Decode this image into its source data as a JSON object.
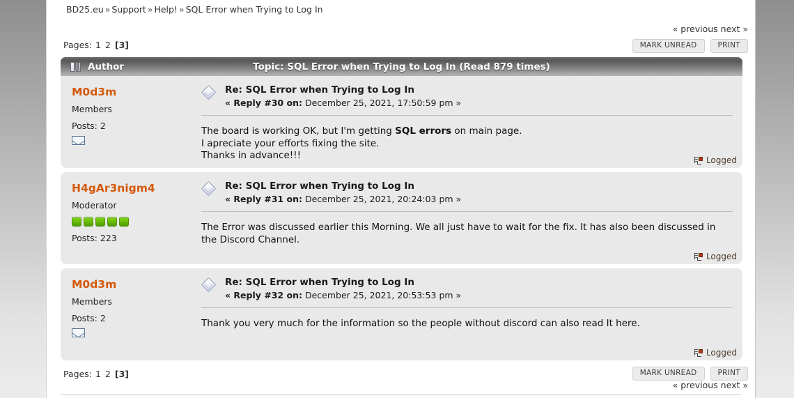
{
  "breadcrumb": {
    "items": [
      "BD25.eu",
      "Support",
      "Help!",
      "SQL Error when Trying to Log In"
    ],
    "separator": "»"
  },
  "pagination": {
    "label": "Pages:",
    "pages": [
      "1",
      "2",
      "3"
    ],
    "current": "3",
    "current_display": "[3]"
  },
  "prevnext": {
    "previous": "« previous",
    "next": "next »"
  },
  "buttons": {
    "mark_unread": "MARK UNREAD",
    "print": "PRINT"
  },
  "table_header": {
    "author_label": "Author",
    "topic_label": "Topic: SQL Error when Trying to Log In  (Read 879 times)",
    "board_icon": "board-icon"
  },
  "posts": [
    {
      "author": "M0d3m",
      "group": "Members",
      "stars": 0,
      "posts_label": "Posts: 2",
      "email_icon": "envelope-icon",
      "subject": "Re: SQL Error when Trying to Log In",
      "reply_label": "« Reply #30 on:",
      "date": "December 25, 2021, 17:50:59 pm »",
      "body_lines": [
        "The board is working OK, but I'm getting <b>SQL errors</b> on main page.",
        "I apreciate your efforts fixing the site.",
        "Thanks in advance!!!"
      ],
      "logged": "Logged"
    },
    {
      "author": "H4gAr3nigm4",
      "group": "Moderator",
      "stars": 5,
      "posts_label": "Posts: 223",
      "email_icon": "",
      "subject": "Re: SQL Error when Trying to Log In",
      "reply_label": "« Reply #31 on:",
      "date": "December 25, 2021, 20:24:03 pm »",
      "body_lines": [
        "The Error was discussed earlier this Morning.  We all just have to wait for the fix.  It has also been discussed in the Discord Channel."
      ],
      "logged": "Logged"
    },
    {
      "author": "M0d3m",
      "group": "Members",
      "stars": 0,
      "posts_label": "Posts: 2",
      "email_icon": "envelope-icon",
      "subject": "Re: SQL Error when Trying to Log In",
      "reply_label": "« Reply #32 on:",
      "date": "December 25, 2021, 20:53:53 pm »",
      "body_lines": [
        "Thank you very much for the information so the people without discord can also read It here."
      ],
      "logged": "Logged"
    }
  ],
  "colors": {
    "username": "#d4590b",
    "star_green": "#6bc10a",
    "post_bg": "#e9e9e9",
    "header_bar": "#575757"
  }
}
